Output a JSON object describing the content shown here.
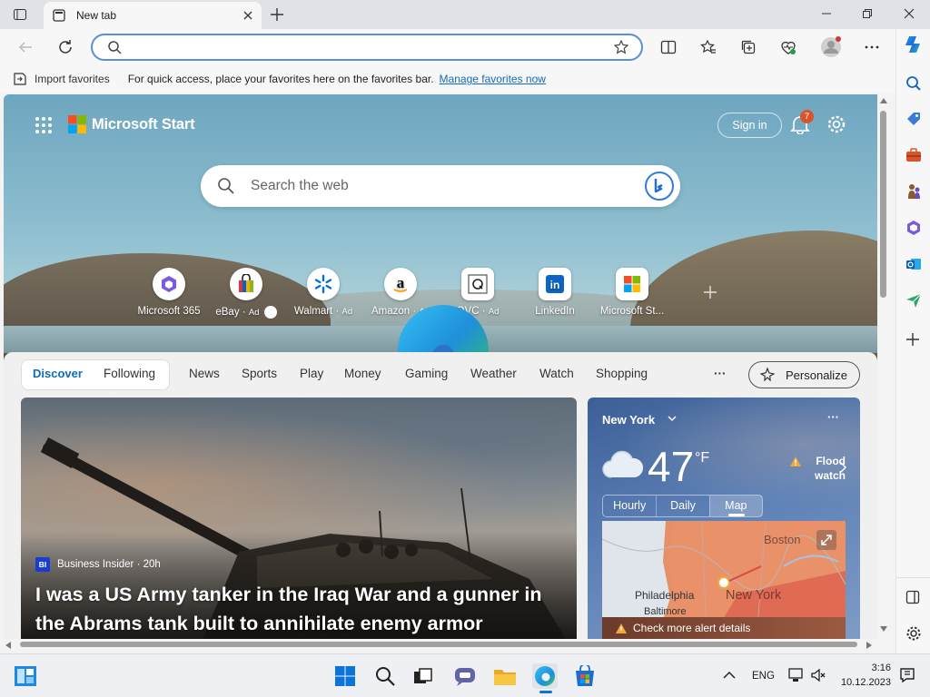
{
  "tabbar": {
    "tab_title": "New tab"
  },
  "favorites": {
    "import_label": "Import favorites",
    "message": "For quick access, place your favorites here on the favorites bar.",
    "manage_link": "Manage favorites now"
  },
  "start": {
    "brand": "Microsoft Start",
    "sign_in": "Sign in",
    "notification_count": "7",
    "search_placeholder": "Search the web"
  },
  "quicklinks": [
    {
      "label": "Microsoft 365",
      "ad": ""
    },
    {
      "label": "eBay",
      "ad": "Ad"
    },
    {
      "label": "Walmart",
      "ad": "Ad"
    },
    {
      "label": "Amazon",
      "ad": "Ad"
    },
    {
      "label": "QVC",
      "ad": "Ad"
    },
    {
      "label": "LinkedIn",
      "ad": ""
    },
    {
      "label": "Microsoft St...",
      "ad": ""
    }
  ],
  "nav": {
    "discover": "Discover",
    "following": "Following",
    "items": [
      "News",
      "Sports",
      "Play",
      "Money",
      "Gaming",
      "Weather",
      "Watch",
      "Shopping"
    ],
    "more": "···",
    "personalize": "Personalize"
  },
  "hero": {
    "source_badge": "BI",
    "source": "Business Insider · 20h",
    "headline": "I was a US Army tanker in the Iraq War and a gunner in the Abrams tank built to annihilate enemy armor"
  },
  "weather": {
    "location": "New York",
    "more": "···",
    "temp": "47",
    "unit": "°F",
    "alert": "Flood watch",
    "tabs": [
      "Hourly",
      "Daily",
      "Map"
    ],
    "active_tab": "Map",
    "map_labels": {
      "boston": "Boston",
      "philadelphia": "Philadelphia",
      "new_york": "New York",
      "baltimore": "Baltimore"
    },
    "alert_details": "Check more alert details"
  },
  "taskbar": {
    "lang": "ENG",
    "time": "3:16",
    "date": "10.12.2023"
  },
  "colors": {
    "accent": "#0f6cbd",
    "alert_overlay": "#e8733c",
    "weather_bg": "#4a6ea5"
  }
}
